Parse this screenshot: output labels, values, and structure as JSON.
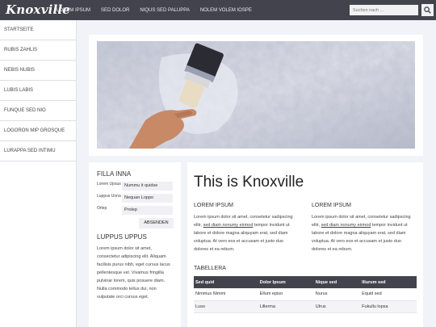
{
  "header": {
    "logo": "Knoxville",
    "nav": [
      "LOREM IPSUM",
      "SED DOLOR",
      "NIQUS SED PALUPPA",
      "NOLEM VOLEM IOSPE"
    ],
    "search_placeholder": "Suchen nach ...",
    "search_icon": "search-icon"
  },
  "sidebar": {
    "items": [
      "STARTSEITE",
      "RUBIS ZAHLIS",
      "NEBIS NUBIS",
      "LUBIS LABIS",
      "FUNQUE SED NIO",
      "LOGORON MIP GROSQUE",
      "LURAPPA SED INTIMU"
    ]
  },
  "filter": {
    "title": "FILLA INNA",
    "fields": [
      {
        "label": "Lorem Upsus",
        "value": "Nummu it quidse"
      },
      {
        "label": "Luppus Unna",
        "value": "Nequan Loppo"
      },
      {
        "label": "Orlep",
        "value": "Prolep"
      }
    ],
    "submit": "ABSENDEN",
    "section2_title": "LUPPUS UPPUS",
    "section2_text": "Lorem ipsum dolor sit amet, consectetur adipiscing elit. Aliquam facilisis purus nibh, eget cursus lacus pellentesque vel. Vivamus fringilla pulvinar lorem, quis posuere diam. Nulla commodo tellus dui, non vulputate orci cursus eget."
  },
  "main": {
    "title": "This is Knoxville",
    "columns": [
      {
        "heading": "LOREM IPSUM",
        "text_a": "Lorem ipsum dolor sit amet, consetetur sadipscing elitr, ",
        "link": "sed diam nonumy eirmod",
        "text_b": " tempor invidunt ut labore et dolore magna aliquyam erat, sed diam voluptua. At vero eos et accusam et justo duo dolores et ea rebum."
      },
      {
        "heading": "LOREM IPSUM",
        "text_a": "Lorem ipsum dolor sit amet, consetetur sadipscing elitr, ",
        "link": "sed diam nonumy eirmod",
        "text_b": " tempor invidunt ut labore et dolore magna aliquyam erat, sed diam voluptua. At vero eos et accusam et justo duo dolores et ea rebum."
      }
    ],
    "table_title": "TABELLERA",
    "table": {
      "headers": [
        "Sed quid",
        "Dolor Ipsum",
        "Nique sed",
        "Illurum sed"
      ],
      "rows": [
        [
          "Nimmus Nimmi",
          "Ellum episo",
          "Nurus",
          "Equid sed"
        ],
        [
          "Luso",
          "Lillerma",
          "Ulrus",
          "Fukullu lopsa"
        ]
      ]
    }
  },
  "colors": {
    "topbar": "#43434d",
    "table_header": "#43434d",
    "background": "#f2f3f8"
  }
}
